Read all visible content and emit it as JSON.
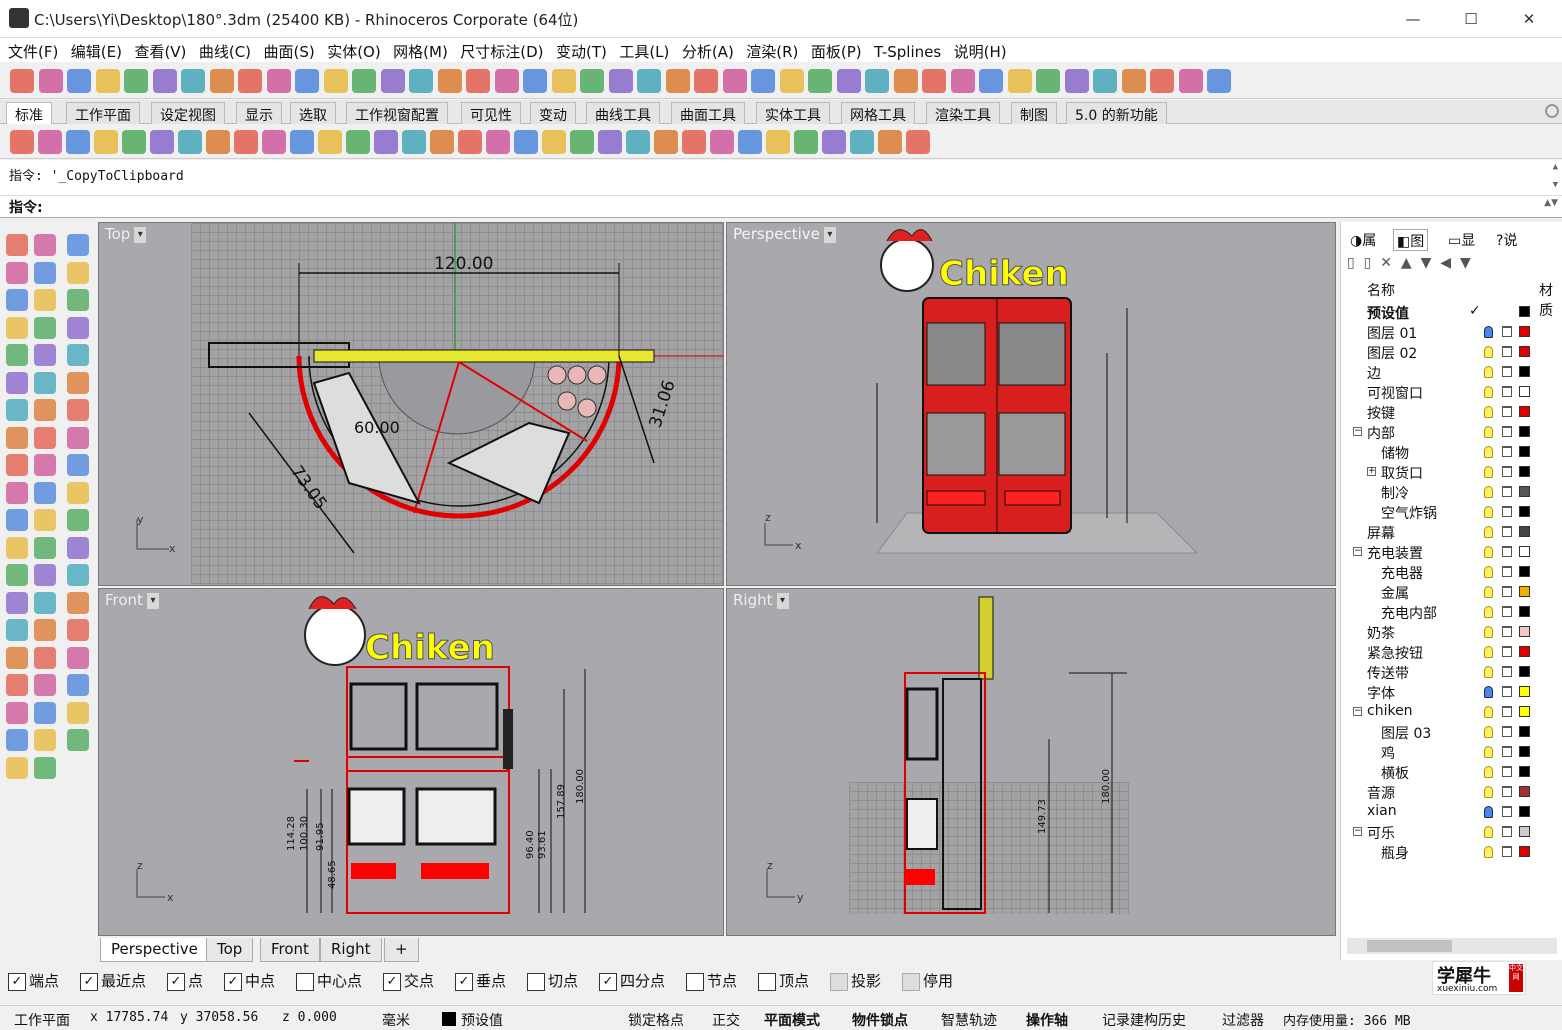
{
  "window": {
    "title": "C:\\Users\\Yi\\Desktop\\180°.3dm (25400 KB) - Rhinoceros Corporate (64位)",
    "minimize": "—",
    "maximize": "☐",
    "close": "✕"
  },
  "menu": [
    "文件(F)",
    "编辑(E)",
    "查看(V)",
    "曲线(C)",
    "曲面(S)",
    "实体(O)",
    "网格(M)",
    "尺寸标注(D)",
    "变动(T)",
    "工具(L)",
    "分析(A)",
    "渲染(R)",
    "面板(P)",
    "T-Splines",
    "说明(H)"
  ],
  "toolbar_tabs": [
    "标准",
    "工作平面",
    "设定视图",
    "显示",
    "选取",
    "工作视窗配置",
    "可见性",
    "变动",
    "曲线工具",
    "曲面工具",
    "实体工具",
    "网格工具",
    "渲染工具",
    "制图",
    "5.0 的新功能"
  ],
  "command": {
    "history": "指令: '_CopyToClipboard",
    "prompt": "指令:"
  },
  "viewports": {
    "top": {
      "title": "Top",
      "dims": [
        "120.00",
        "60.00",
        "31.06",
        "73.05"
      ],
      "axis_x": "x",
      "axis_y": "y"
    },
    "perspective": {
      "title": "Perspective",
      "axis_x": "x",
      "axis_y": "z",
      "logo": "Chiken"
    },
    "front": {
      "title": "Front",
      "axis_x": "x",
      "axis_y": "z",
      "logo": "Chiken",
      "dims": [
        "114.28",
        "100.30",
        "91.95",
        "48.65",
        "96.40",
        "93.61",
        "157.89",
        "180.00"
      ]
    },
    "right": {
      "title": "Right",
      "axis_x": "y",
      "axis_y": "z",
      "dims": [
        "149.73",
        "180.00"
      ]
    }
  },
  "viewport_tabs": [
    "Perspective",
    "Top",
    "Front",
    "Right",
    "+"
  ],
  "osnaps": [
    {
      "label": "端点",
      "checked": true
    },
    {
      "label": "最近点",
      "checked": true
    },
    {
      "label": "点",
      "checked": true
    },
    {
      "label": "中点",
      "checked": true
    },
    {
      "label": "中心点",
      "checked": false
    },
    {
      "label": "交点",
      "checked": true
    },
    {
      "label": "垂点",
      "checked": true
    },
    {
      "label": "切点",
      "checked": false
    },
    {
      "label": "四分点",
      "checked": true
    },
    {
      "label": "节点",
      "checked": false
    },
    {
      "label": "顶点",
      "checked": false
    },
    {
      "label": "投影",
      "checked": false
    },
    {
      "label": "停用",
      "checked": false
    }
  ],
  "statusbar": {
    "cplane": "工作平面",
    "x": "x 17785.74",
    "y": "y 37058.56",
    "z": "z 0.000",
    "unit": "毫米",
    "layer": "预设值",
    "items": [
      "锁定格点",
      "正交",
      "平面模式",
      "物件锁点",
      "智慧轨迹",
      "操作轴",
      "记录建构历史",
      "过滤器"
    ],
    "memory": "内存使用量: 366 MB"
  },
  "panel": {
    "tabs": [
      "属",
      "图",
      "显",
      "说"
    ],
    "header": {
      "name": "名称",
      "material": "材质"
    },
    "layers": [
      {
        "name": "预设值",
        "indent": 0,
        "current": true,
        "color": "#000000",
        "bulb": "on_yellow"
      },
      {
        "name": "图层 01",
        "indent": 0,
        "color": "#e00000",
        "bulb": "blue"
      },
      {
        "name": "图层 02",
        "indent": 0,
        "color": "#e00000",
        "bulb": "yellow"
      },
      {
        "name": "边",
        "indent": 0,
        "color": "#000000",
        "bulb": "yellow"
      },
      {
        "name": "可视窗口",
        "indent": 0,
        "color": "#ffffff",
        "bulb": "yellow"
      },
      {
        "name": "按键",
        "indent": 0,
        "color": "#e00000",
        "bulb": "yellow"
      },
      {
        "name": "内部",
        "indent": 0,
        "toggle": "−",
        "color": "#000000",
        "bulb": "yellow"
      },
      {
        "name": "储物",
        "indent": 1,
        "color": "#000000",
        "bulb": "yellow"
      },
      {
        "name": "取货口",
        "indent": 1,
        "toggle": "+",
        "color": "#000000",
        "bulb": "yellow"
      },
      {
        "name": "制冷",
        "indent": 1,
        "color": "#555555",
        "bulb": "yellow"
      },
      {
        "name": "空气炸锅",
        "indent": 1,
        "color": "#000000",
        "bulb": "yellow"
      },
      {
        "name": "屏幕",
        "indent": 0,
        "color": "#444444",
        "bulb": "yellow"
      },
      {
        "name": "充电装置",
        "indent": 0,
        "toggle": "−",
        "color": "#ffffff",
        "bulb": "yellow"
      },
      {
        "name": "充电器",
        "indent": 1,
        "color": "#000000",
        "bulb": "yellow"
      },
      {
        "name": "金属",
        "indent": 1,
        "color": "#f0b000",
        "bulb": "yellow"
      },
      {
        "name": "充电内部",
        "indent": 1,
        "color": "#000000",
        "bulb": "yellow"
      },
      {
        "name": "奶茶",
        "indent": 0,
        "color": "#f4c6c6",
        "bulb": "yellow"
      },
      {
        "name": "紧急按钮",
        "indent": 0,
        "color": "#e00000",
        "bulb": "yellow"
      },
      {
        "name": "传送带",
        "indent": 0,
        "color": "#000000",
        "bulb": "yellow"
      },
      {
        "name": "字体",
        "indent": 0,
        "color": "#ffff00",
        "bulb": "blue"
      },
      {
        "name": "chiken",
        "indent": 0,
        "toggle": "−",
        "color": "#ffff00",
        "bulb": "yellow"
      },
      {
        "name": "图层 03",
        "indent": 1,
        "color": "#000000",
        "bulb": "yellow"
      },
      {
        "name": "鸡",
        "indent": 1,
        "color": "#000000",
        "bulb": "yellow"
      },
      {
        "name": "横板",
        "indent": 1,
        "color": "#000000",
        "bulb": "yellow"
      },
      {
        "name": "音源",
        "indent": 0,
        "color": "#a03030",
        "bulb": "yellow"
      },
      {
        "name": "xian",
        "indent": 0,
        "color": "#000000",
        "bulb": "blue"
      },
      {
        "name": "可乐",
        "indent": 0,
        "toggle": "−",
        "color": "#cccccc",
        "bulb": "yellow"
      },
      {
        "name": "瓶身",
        "indent": 1,
        "color": "#e00000",
        "bulb": "yellow"
      }
    ]
  },
  "watermark": {
    "brand": "学犀牛",
    "sub": "xuexiniu.com",
    "tag": "中文网"
  }
}
